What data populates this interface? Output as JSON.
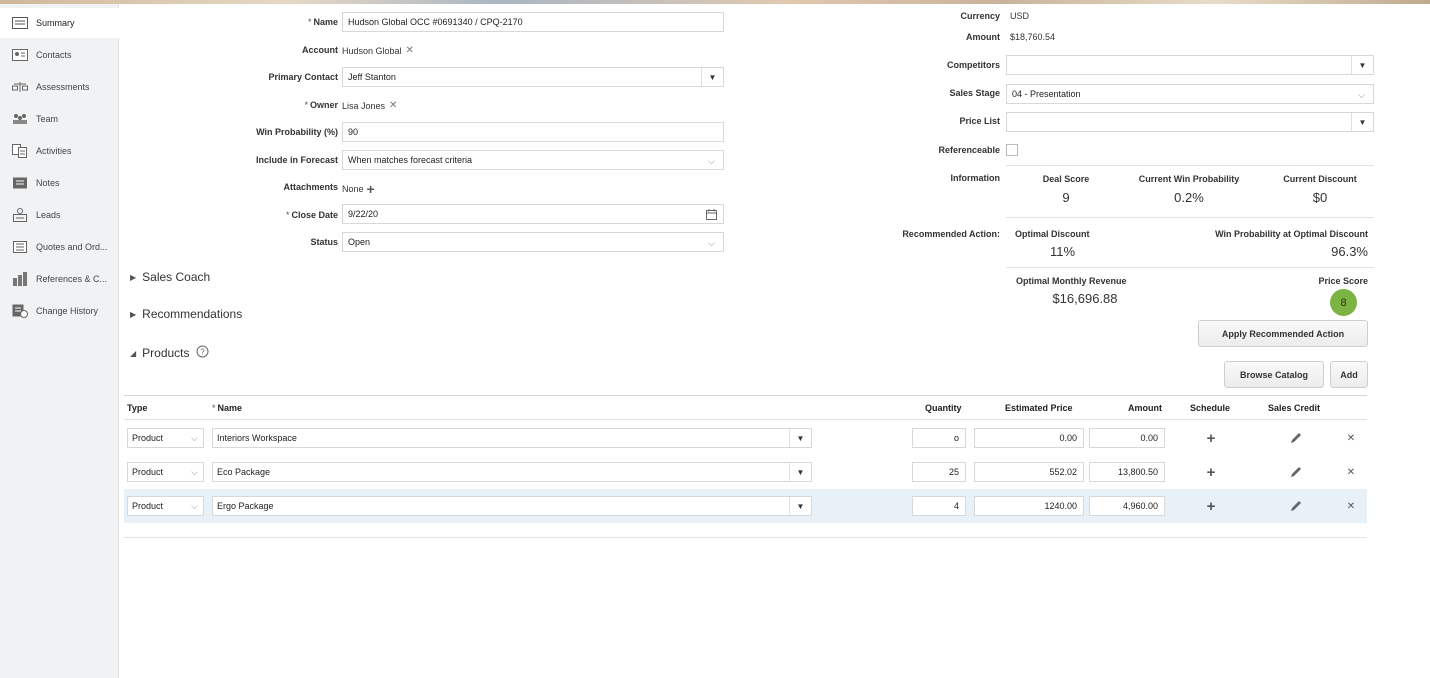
{
  "sidebar": {
    "items": [
      {
        "label": "Summary",
        "icon": "summary-icon"
      },
      {
        "label": "Contacts",
        "icon": "contacts-icon"
      },
      {
        "label": "Assessments",
        "icon": "assessments-icon"
      },
      {
        "label": "Team",
        "icon": "team-icon"
      },
      {
        "label": "Activities",
        "icon": "activities-icon"
      },
      {
        "label": "Notes",
        "icon": "notes-icon"
      },
      {
        "label": "Leads",
        "icon": "leads-icon"
      },
      {
        "label": "Quotes and Ord...",
        "icon": "quotes-icon"
      },
      {
        "label": "References & C...",
        "icon": "references-icon"
      },
      {
        "label": "Change History",
        "icon": "history-icon"
      }
    ]
  },
  "form": {
    "name_label": "Name",
    "name_value": "Hudson Global OCC #0691340 / CPQ-2170",
    "account_label": "Account",
    "account_value": "Hudson Global",
    "primary_contact_label": "Primary Contact",
    "primary_contact_value": "Jeff Stanton",
    "owner_label": "Owner",
    "owner_value": "Lisa Jones",
    "win_prob_label": "Win Probability (%)",
    "win_prob_value": "90",
    "forecast_label": "Include in Forecast",
    "forecast_value": "When matches forecast criteria",
    "attachments_label": "Attachments",
    "attachments_value": "None",
    "close_date_label": "Close Date",
    "close_date_value": "9/22/20",
    "status_label": "Status",
    "status_value": "Open",
    "required_marker": "*"
  },
  "right": {
    "currency_label": "Currency",
    "currency_value": "USD",
    "amount_label": "Amount",
    "amount_value": "$18,760.54",
    "competitors_label": "Competitors",
    "competitors_value": "",
    "sales_stage_label": "Sales Stage",
    "sales_stage_value": "04 - Presentation",
    "price_list_label": "Price List",
    "price_list_value": "",
    "referenceable_label": "Referenceable",
    "information_label": "Information",
    "deal_score_label": "Deal Score",
    "deal_score_value": "9",
    "current_win_label": "Current Win Probability",
    "current_win_value": "0.2%",
    "current_discount_label": "Current Discount",
    "current_discount_value": "$0",
    "recommended_label": "Recommended Action:",
    "optimal_discount_label": "Optimal Discount",
    "optimal_discount_value": "11%",
    "win_at_optimal_label": "Win Probability at Optimal Discount",
    "win_at_optimal_value": "96.3%",
    "optimal_revenue_label": "Optimal Monthly Revenue",
    "optimal_revenue_value": "$16,696.88",
    "price_score_label": "Price Score",
    "price_score_value": "8",
    "price_score_color": "#7cb342",
    "apply_button": "Apply Recommended Action",
    "browse_button": "Browse Catalog",
    "add_button": "Add"
  },
  "sections": {
    "sales_coach": "Sales Coach",
    "recommendations": "Recommendations",
    "products": "Products"
  },
  "products": {
    "headers": {
      "type": "Type",
      "name": "Name",
      "quantity": "Quantity",
      "estimated_price": "Estimated Price",
      "amount": "Amount",
      "schedule": "Schedule",
      "sales_credit": "Sales Credit"
    },
    "rows": [
      {
        "type": "Product",
        "name": "Interiors Workspace",
        "quantity": "o",
        "price": "0.00",
        "amount": "0.00"
      },
      {
        "type": "Product",
        "name": "Eco Package",
        "quantity": "25",
        "price": "552.02",
        "amount": "13,800.50"
      },
      {
        "type": "Product",
        "name": "Ergo Package",
        "quantity": "4",
        "price": "1240.00",
        "amount": "4,960.00"
      }
    ]
  }
}
